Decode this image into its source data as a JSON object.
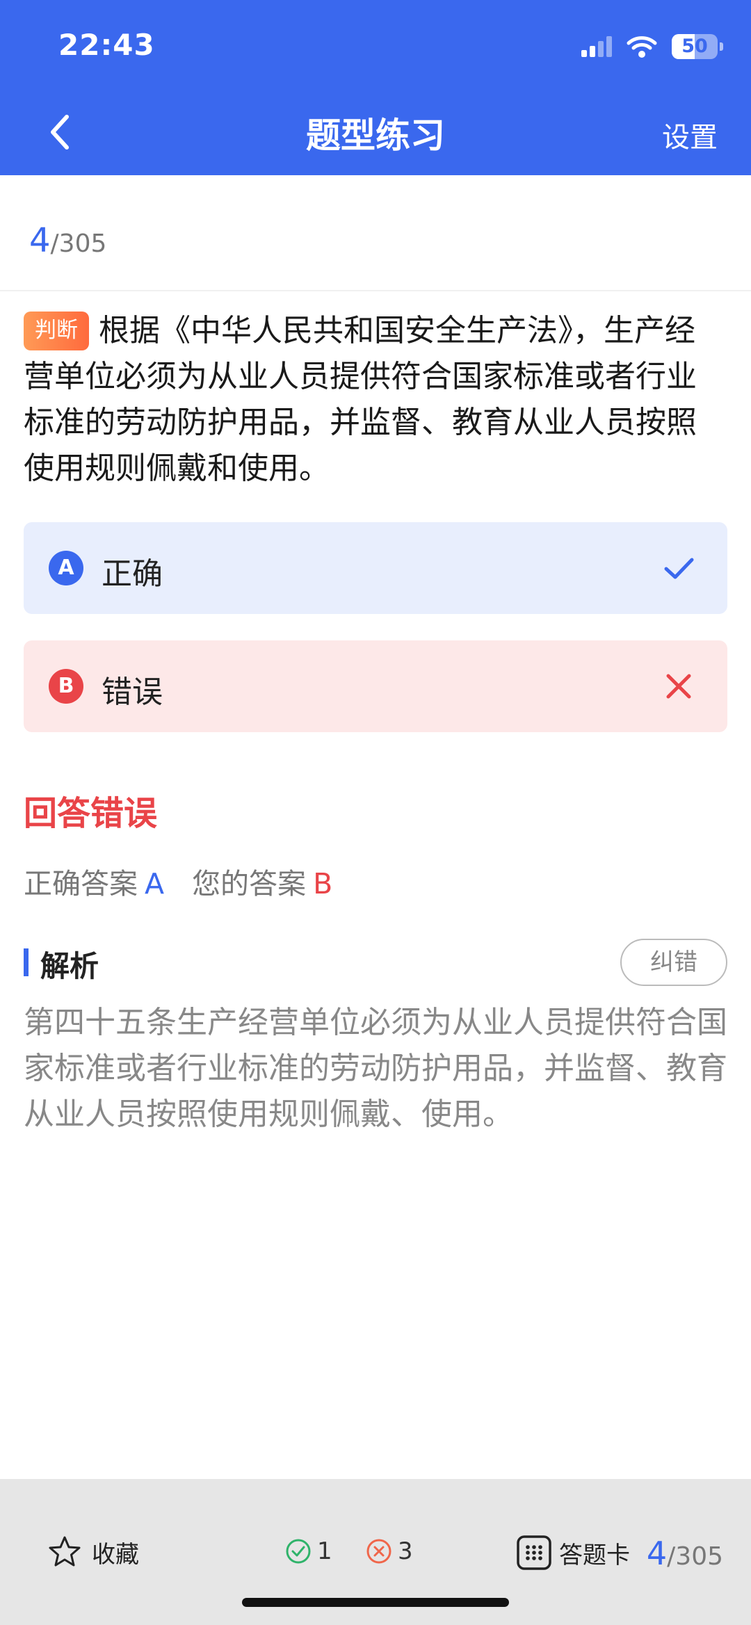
{
  "status_bar": {
    "time": "22:43",
    "battery_level": "50",
    "battery_fraction": 0.5,
    "icons": [
      "signal-icon",
      "wifi-icon",
      "battery-icon"
    ]
  },
  "header": {
    "title": "题型练习",
    "settings_label": "设置",
    "back_icon": "chevron-left-icon",
    "bg_color": "#3a68ee"
  },
  "progress": {
    "current": "4",
    "total": "/305"
  },
  "question": {
    "type_label": "判断",
    "text": "根据《中华人民共和国安全生产法》，生产经营单位必须为从业人员提供符合国家标准或者行业标准的劳动防护用品，并监督、教育从业人员按照使用规则佩戴和使用。"
  },
  "options": [
    {
      "letter": "A",
      "text": "正确",
      "state": "correct",
      "mark_icon": "check-icon"
    },
    {
      "letter": "B",
      "text": "错误",
      "state": "wrong",
      "mark_icon": "cross-icon"
    }
  ],
  "result": {
    "title": "回答错误",
    "correct_label": "正确答案",
    "correct_value": "A",
    "yours_label": "您的答案",
    "yours_value": "B"
  },
  "analysis": {
    "title": "解析",
    "report_label": "纠错",
    "text": "第四十五条生产经营单位必须为从业人员提供符合国家标准或者行业标准的劳动防护用品，并监督、教育从业人员按照使用规则佩戴、使用。"
  },
  "bottom_bar": {
    "favorite_label": "收藏",
    "correct_count": "1",
    "wrong_count": "3",
    "card_label": "答题卡",
    "progress_current": "4",
    "progress_total": "/305"
  },
  "colors": {
    "accent": "#3a68ee",
    "error": "#e94448",
    "success": "#2fb36a"
  }
}
